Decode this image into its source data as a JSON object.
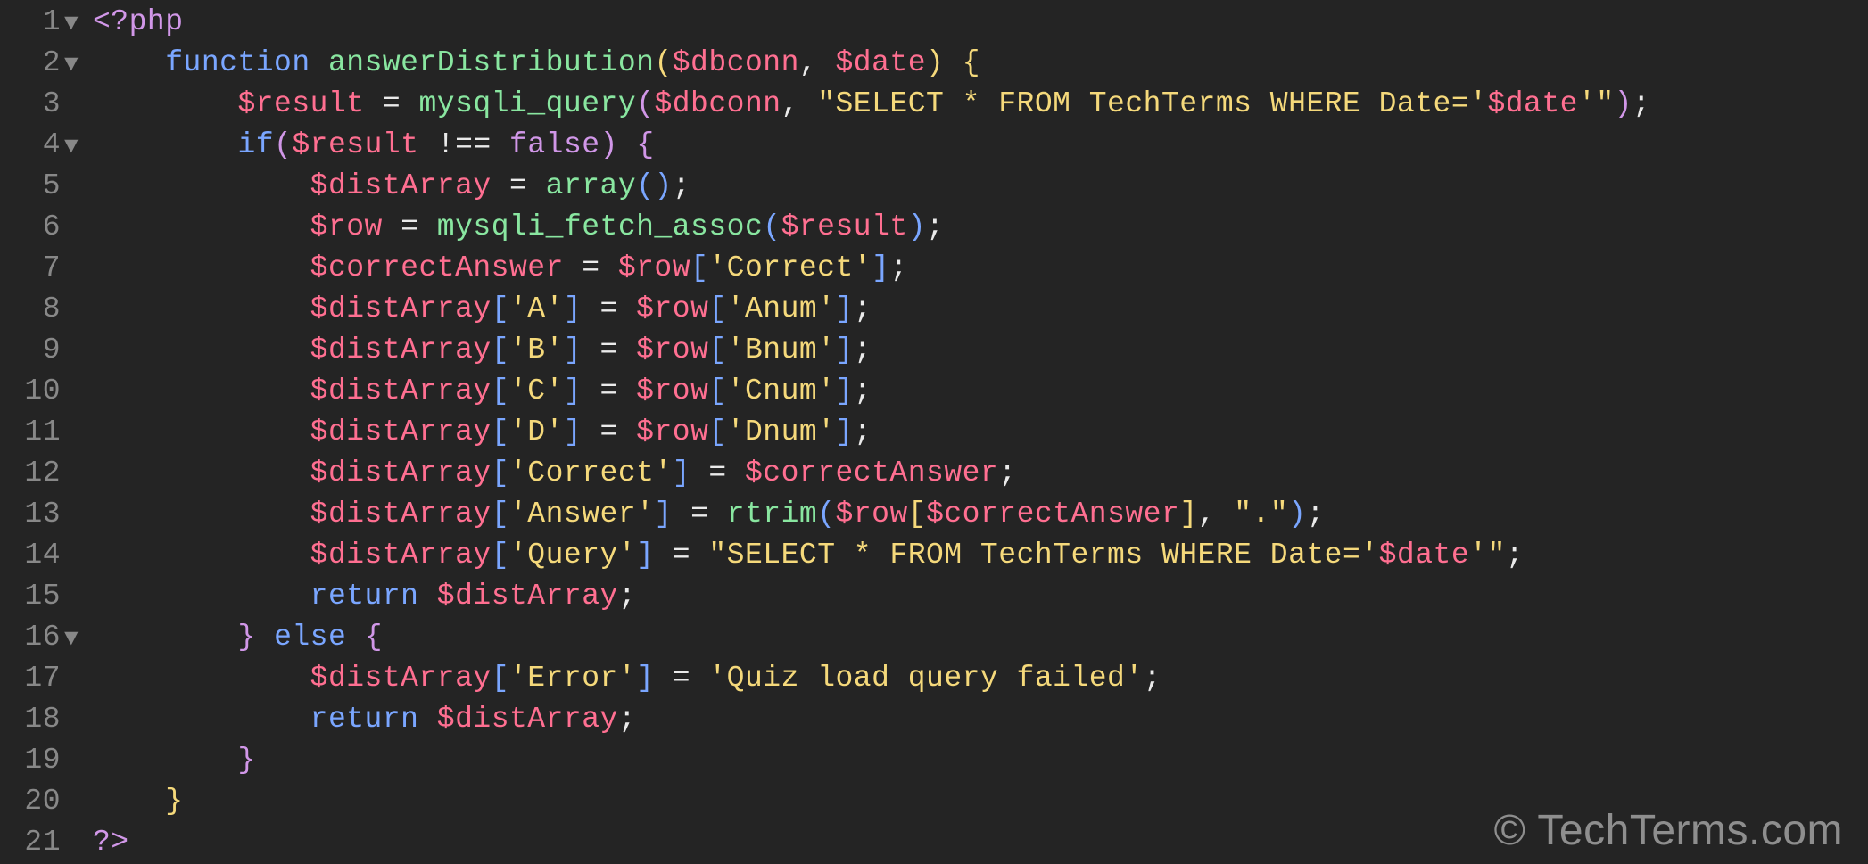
{
  "watermark": "© TechTerms.com",
  "lines": [
    {
      "num": "1",
      "fold": "▼"
    },
    {
      "num": "2",
      "fold": "▼"
    },
    {
      "num": "3",
      "fold": ""
    },
    {
      "num": "4",
      "fold": "▼"
    },
    {
      "num": "5",
      "fold": ""
    },
    {
      "num": "6",
      "fold": ""
    },
    {
      "num": "7",
      "fold": ""
    },
    {
      "num": "8",
      "fold": ""
    },
    {
      "num": "9",
      "fold": ""
    },
    {
      "num": "10",
      "fold": ""
    },
    {
      "num": "11",
      "fold": ""
    },
    {
      "num": "12",
      "fold": ""
    },
    {
      "num": "13",
      "fold": ""
    },
    {
      "num": "14",
      "fold": ""
    },
    {
      "num": "15",
      "fold": ""
    },
    {
      "num": "16",
      "fold": "▼"
    },
    {
      "num": "17",
      "fold": ""
    },
    {
      "num": "18",
      "fold": ""
    },
    {
      "num": "19",
      "fold": ""
    },
    {
      "num": "20",
      "fold": ""
    },
    {
      "num": "21",
      "fold": ""
    }
  ],
  "tokens": {
    "open_tag": "<?php",
    "close_tag": "?>",
    "function_kw": "function",
    "fn_name": "answerDistribution",
    "dbconn": "$dbconn",
    "date": "$date",
    "result": "$result",
    "mysqli_query": "mysqli_query",
    "select_prefix": "\"SELECT * FROM TechTerms WHERE Date='",
    "select_suffix": "'\"",
    "if_kw": "if",
    "neq": "!==",
    "false_kw": "false",
    "distArray": "$distArray",
    "array_fn": "array",
    "row": "$row",
    "mysqli_fetch_assoc": "mysqli_fetch_assoc",
    "correctAnswer": "$correctAnswer",
    "key_Correct": "'Correct'",
    "key_A": "'A'",
    "key_B": "'B'",
    "key_C": "'C'",
    "key_D": "'D'",
    "key_Anum": "'Anum'",
    "key_Bnum": "'Bnum'",
    "key_Cnum": "'Cnum'",
    "key_Dnum": "'Dnum'",
    "key_Answer": "'Answer'",
    "key_Query": "'Query'",
    "key_Error": "'Error'",
    "rtrim": "rtrim",
    "dot_str": "\".\"",
    "return_kw": "return",
    "else_kw": "else",
    "quiz_failed": "'Quiz load query failed'",
    "eq": "=",
    "comma": ",",
    "semi": ";",
    "lparen": "(",
    "rparen": ")",
    "lbrace": "{",
    "rbrace": "}",
    "lbracket": "[",
    "rbracket": "]"
  }
}
